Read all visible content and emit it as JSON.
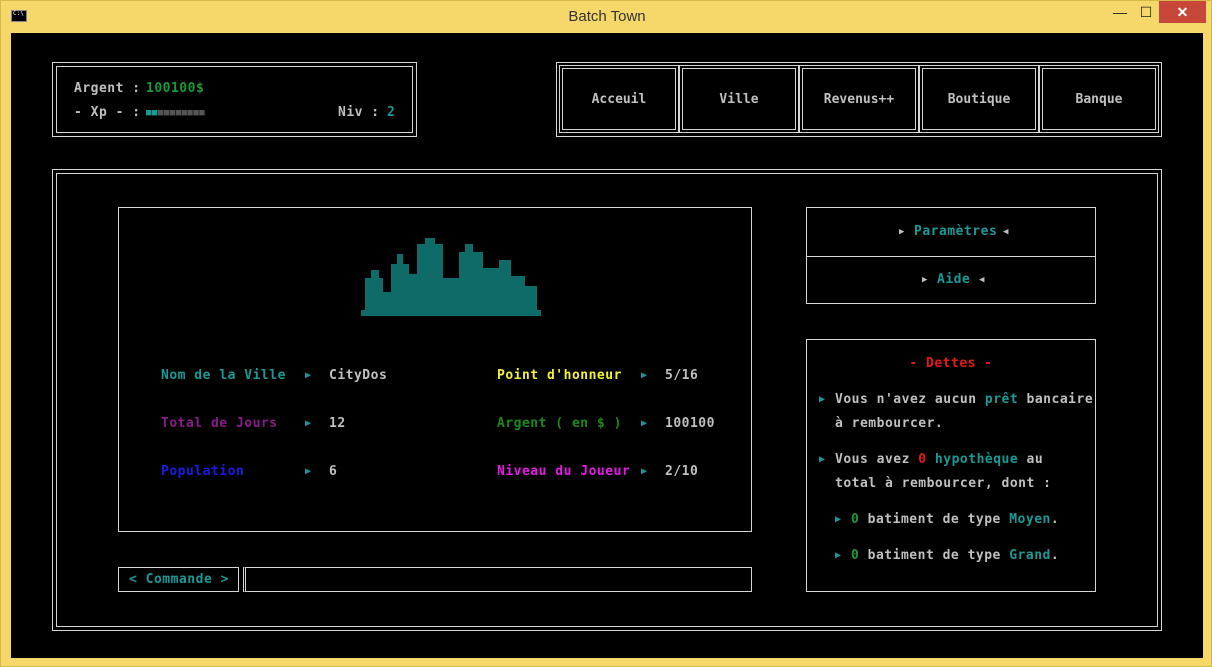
{
  "window": {
    "title": "Batch Town",
    "minimize": "—",
    "maximize": "☐",
    "close": "✕"
  },
  "status": {
    "argent_label": "Argent :",
    "argent_value": "100100$",
    "xp_label": "- Xp - :",
    "xp_bar": "■■■■■■■■■■",
    "xp_filled": 2,
    "xp_total": 10,
    "niv_label": "Niv :",
    "niv_value": "2"
  },
  "nav": [
    {
      "label": "Acceuil",
      "active": true
    },
    {
      "label": "Ville",
      "active": false
    },
    {
      "label": "Revenus++",
      "active": false
    },
    {
      "label": "Boutique",
      "active": false
    },
    {
      "label": "Banque",
      "active": false
    }
  ],
  "city": {
    "rows": [
      {
        "label": "Nom de la Ville",
        "color": "#1a9a96",
        "value": "CityDos"
      },
      {
        "label": "Total de Jours",
        "color": "#8a1a8a",
        "value": "12"
      },
      {
        "label": "Population",
        "color": "#1a1ae6",
        "value": "6"
      }
    ],
    "rows_right": [
      {
        "label": "Point d'honneur",
        "color": "#f2f23a",
        "value": "5/16"
      },
      {
        "label": "Argent ( en $ )",
        "color": "#1a8a1a",
        "value": "100100"
      },
      {
        "label": "Niveau du Joueur",
        "color": "#e61ae6",
        "value": "2/10"
      }
    ]
  },
  "command": {
    "label": "< Commande >",
    "value": ""
  },
  "menu": [
    {
      "label": "Paramètres"
    },
    {
      "label": "Aide"
    }
  ],
  "dettes": {
    "title": "- Dettes -",
    "p1_a": "Vous n'avez aucun ",
    "p1_b": "prêt",
    "p1_c": " bancaire",
    "p1_d": "à rembourcer.",
    "p2_a": "Vous avez ",
    "p2_b": "0",
    "p2_c": " hypothèque",
    "p2_d": " au",
    "p2_e": "total à rembourcer, dont :",
    "l1_a": "0",
    "l1_b": " batiment de type ",
    "l1_c": "Moyen",
    "l1_d": ".",
    "l2_a": "0",
    "l2_b": " batiment de type ",
    "l2_c": "Grand",
    "l2_d": "."
  },
  "colors": {
    "teal": "#1a9a96",
    "green": "#1a9a3a",
    "red": "#e61a1a",
    "skyline": "#0f6b68"
  },
  "icons": {
    "arrow": "right-triangle-icon",
    "arrow_left": "left-triangle-icon",
    "skyline": "city-skyline-icon"
  }
}
